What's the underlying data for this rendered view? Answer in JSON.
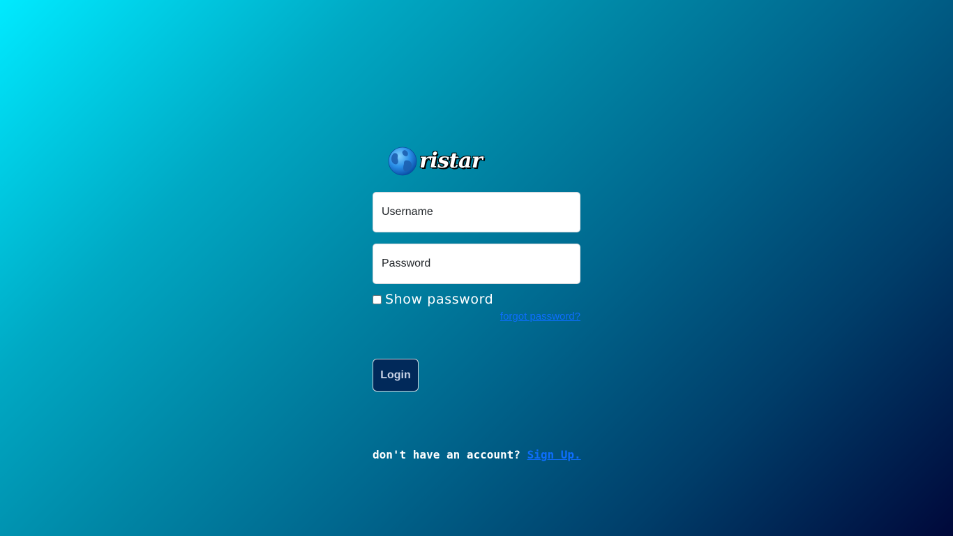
{
  "brand": {
    "logo_icon": "globe-icon",
    "name": "ristar"
  },
  "login_form": {
    "username_placeholder": "Username",
    "password_placeholder": "Password",
    "show_password_label": "Show password",
    "show_password_checked": false,
    "forgot_password_label": "forgot password?",
    "login_button_label": "Login"
  },
  "signup": {
    "prompt": "don't have an account?",
    "link_label": "Sign Up."
  },
  "colors": {
    "background_start": "#00eaff",
    "background_end": "#00083a",
    "button_bg": "#01295a",
    "link": "#0d6efd"
  }
}
